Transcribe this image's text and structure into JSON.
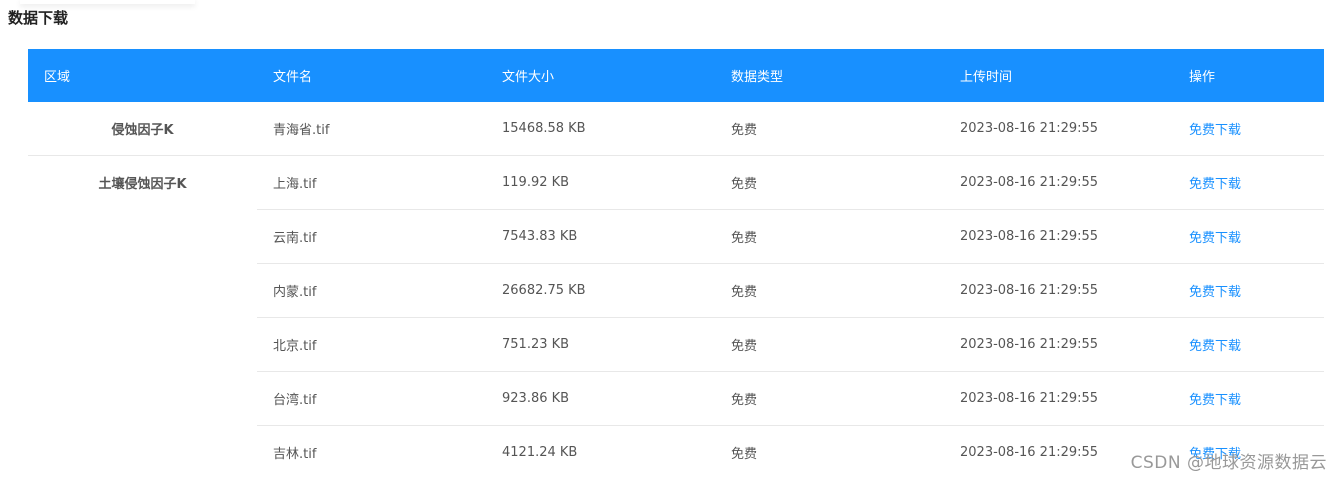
{
  "page_title": "数据下载",
  "table": {
    "headers": [
      "区域",
      "文件名",
      "文件大小",
      "数据类型",
      "上传时间",
      "操作"
    ],
    "groups": [
      {
        "region": "侵蚀因子K",
        "rows": [
          {
            "file": "青海省.tif",
            "size": "15468.58 KB",
            "type": "免费",
            "time": "2023-08-16 21:29:55",
            "action": "免费下载"
          }
        ]
      },
      {
        "region": "土壤侵蚀因子K",
        "rows": [
          {
            "file": "上海.tif",
            "size": "119.92 KB",
            "type": "免费",
            "time": "2023-08-16 21:29:55",
            "action": "免费下载"
          },
          {
            "file": "云南.tif",
            "size": "7543.83 KB",
            "type": "免费",
            "time": "2023-08-16 21:29:55",
            "action": "免费下载"
          },
          {
            "file": "内蒙.tif",
            "size": "26682.75 KB",
            "type": "免费",
            "time": "2023-08-16 21:29:55",
            "action": "免费下载"
          },
          {
            "file": "北京.tif",
            "size": "751.23 KB",
            "type": "免费",
            "time": "2023-08-16 21:29:55",
            "action": "免费下载"
          },
          {
            "file": "台湾.tif",
            "size": "923.86 KB",
            "type": "免费",
            "time": "2023-08-16 21:29:55",
            "action": "免费下载"
          },
          {
            "file": "吉林.tif",
            "size": "4121.24 KB",
            "type": "免费",
            "time": "2023-08-16 21:29:55",
            "action": "免费下载"
          }
        ]
      }
    ]
  },
  "watermark": "CSDN @地球资源数据云",
  "colors": {
    "header_bg": "#1890ff",
    "link": "#1890ff",
    "border": "#e8e8e8"
  }
}
